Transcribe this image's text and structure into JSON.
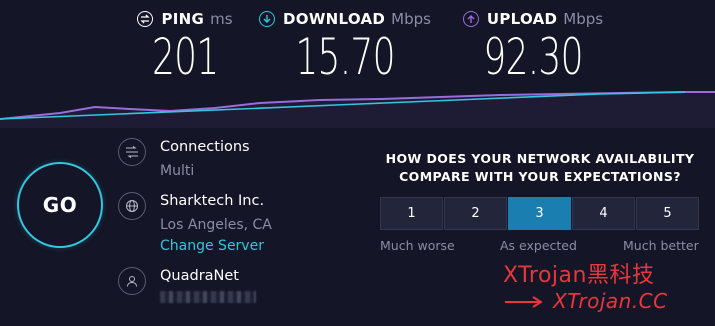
{
  "metrics": {
    "ping": {
      "label": "PING",
      "unit": "ms",
      "value": "201",
      "icon": "ping-icon",
      "color": "#ffffff"
    },
    "download": {
      "label": "DOWNLOAD",
      "unit": "Mbps",
      "value": "15.70",
      "icon": "download-icon",
      "color": "#33c6e0"
    },
    "upload": {
      "label": "UPLOAD",
      "unit": "Mbps",
      "value": "92.30",
      "icon": "upload-icon",
      "color": "#9b6bdb"
    }
  },
  "go_button": {
    "label": "GO"
  },
  "connections": {
    "title": "Connections",
    "value": "Multi",
    "icon": "connections-icon"
  },
  "server": {
    "name": "Sharktech Inc.",
    "location": "Los Angeles, CA",
    "change_label": "Change Server",
    "icon": "globe-icon"
  },
  "isp": {
    "name": "QuadraNet",
    "icon": "user-icon"
  },
  "survey": {
    "question_line1": "HOW DOES YOUR NETWORK AVAILABILITY",
    "question_line2": "COMPARE WITH YOUR EXPECTATIONS?",
    "options": [
      "1",
      "2",
      "3",
      "4",
      "5"
    ],
    "selected": "3",
    "label_low": "Much worse",
    "label_mid": "As expected",
    "label_high": "Much better"
  },
  "watermark": {
    "line1": "XTrojan黑科技",
    "line2": "XTrojan.CC"
  },
  "colors": {
    "accent": "#33c6e0",
    "upload": "#9b6bdb",
    "selected": "#1a7fb0",
    "background": "#141526"
  }
}
